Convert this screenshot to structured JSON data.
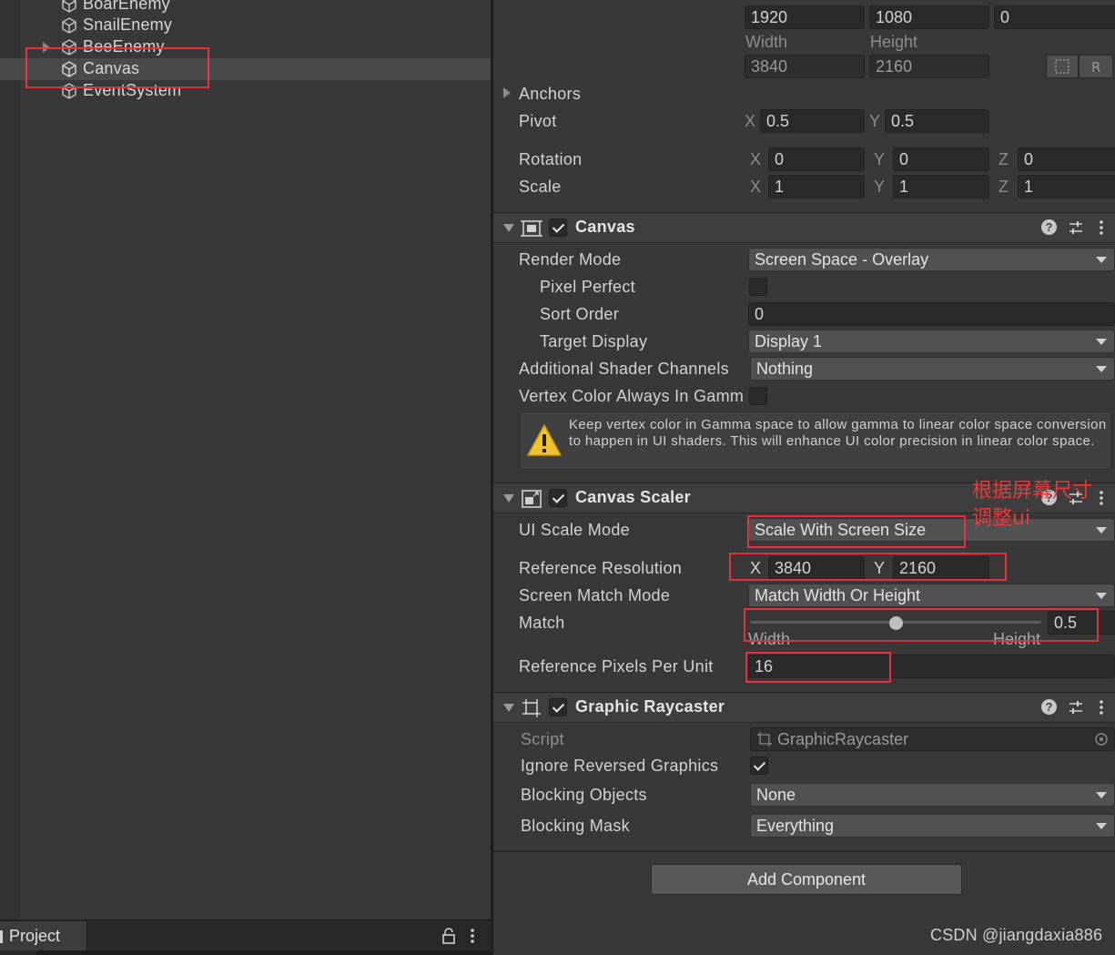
{
  "hierarchy": {
    "items": [
      {
        "label": "BoarEnemy"
      },
      {
        "label": "SnailEnemy"
      },
      {
        "label": "BeeEnemy"
      },
      {
        "label": "Canvas"
      },
      {
        "label": "EventSystem"
      }
    ],
    "selected": "Canvas"
  },
  "project": {
    "tab_label": "Project"
  },
  "rect_transform": {
    "top_values": [
      "1920",
      "1080",
      "0"
    ],
    "width_label": "Width",
    "height_label": "Height",
    "width_value": "3840",
    "height_value": "2160",
    "anchors_label": "Anchors",
    "pivot_label": "Pivot",
    "pivot": {
      "x_label": "X",
      "x": "0.5",
      "y_label": "Y",
      "y": "0.5"
    },
    "rotation_label": "Rotation",
    "rotation": {
      "x_label": "X",
      "x": "0",
      "y_label": "Y",
      "y": "0",
      "z_label": "Z",
      "z": "0"
    },
    "scale_label": "Scale",
    "scale": {
      "x_label": "X",
      "x": "1",
      "y_label": "Y",
      "y": "1",
      "z_label": "Z",
      "z": "1"
    }
  },
  "canvas": {
    "title": "Canvas",
    "render_mode_label": "Render Mode",
    "render_mode": "Screen Space - Overlay",
    "pixel_perfect_label": "Pixel Perfect",
    "sort_order_label": "Sort Order",
    "sort_order": "0",
    "target_display_label": "Target Display",
    "target_display": "Display 1",
    "shader_channels_label": "Additional Shader Channels",
    "shader_channels": "Nothing",
    "vertex_color_label": "Vertex Color Always In Gamm",
    "warning": "Keep vertex color in Gamma space to allow gamma to linear color space conversion to happen in UI shaders. This will enhance UI color precision in linear color space."
  },
  "canvas_scaler": {
    "title": "Canvas Scaler",
    "ui_scale_mode_label": "UI Scale Mode",
    "ui_scale_mode": "Scale With Screen Size",
    "ref_resolution_label": "Reference Resolution",
    "ref_x_label": "X",
    "ref_x": "3840",
    "ref_y_label": "Y",
    "ref_y": "2160",
    "screen_match_mode_label": "Screen Match Mode",
    "screen_match_mode": "Match Width Or Height",
    "match_label": "Match",
    "match_value": "0.5",
    "match_fraction": 0.5,
    "match_min_label": "Width",
    "match_max_label": "Height",
    "ref_ppu_label": "Reference Pixels Per Unit",
    "ref_ppu": "16",
    "annotation_line1": "根据屏幕尺寸",
    "annotation_line2": "调整ui"
  },
  "graphic_raycaster": {
    "title": "Graphic Raycaster",
    "script_label": "Script",
    "script_value": "GraphicRaycaster",
    "ignore_reversed_label": "Ignore Reversed Graphics",
    "blocking_objects_label": "Blocking Objects",
    "blocking_objects": "None",
    "blocking_mask_label": "Blocking Mask",
    "blocking_mask": "Everything"
  },
  "add_component_label": "Add Component",
  "watermark": "CSDN @jiangdaxia886",
  "colors": {
    "annotation_red": "#e8303a",
    "panel_bg": "#383838"
  }
}
